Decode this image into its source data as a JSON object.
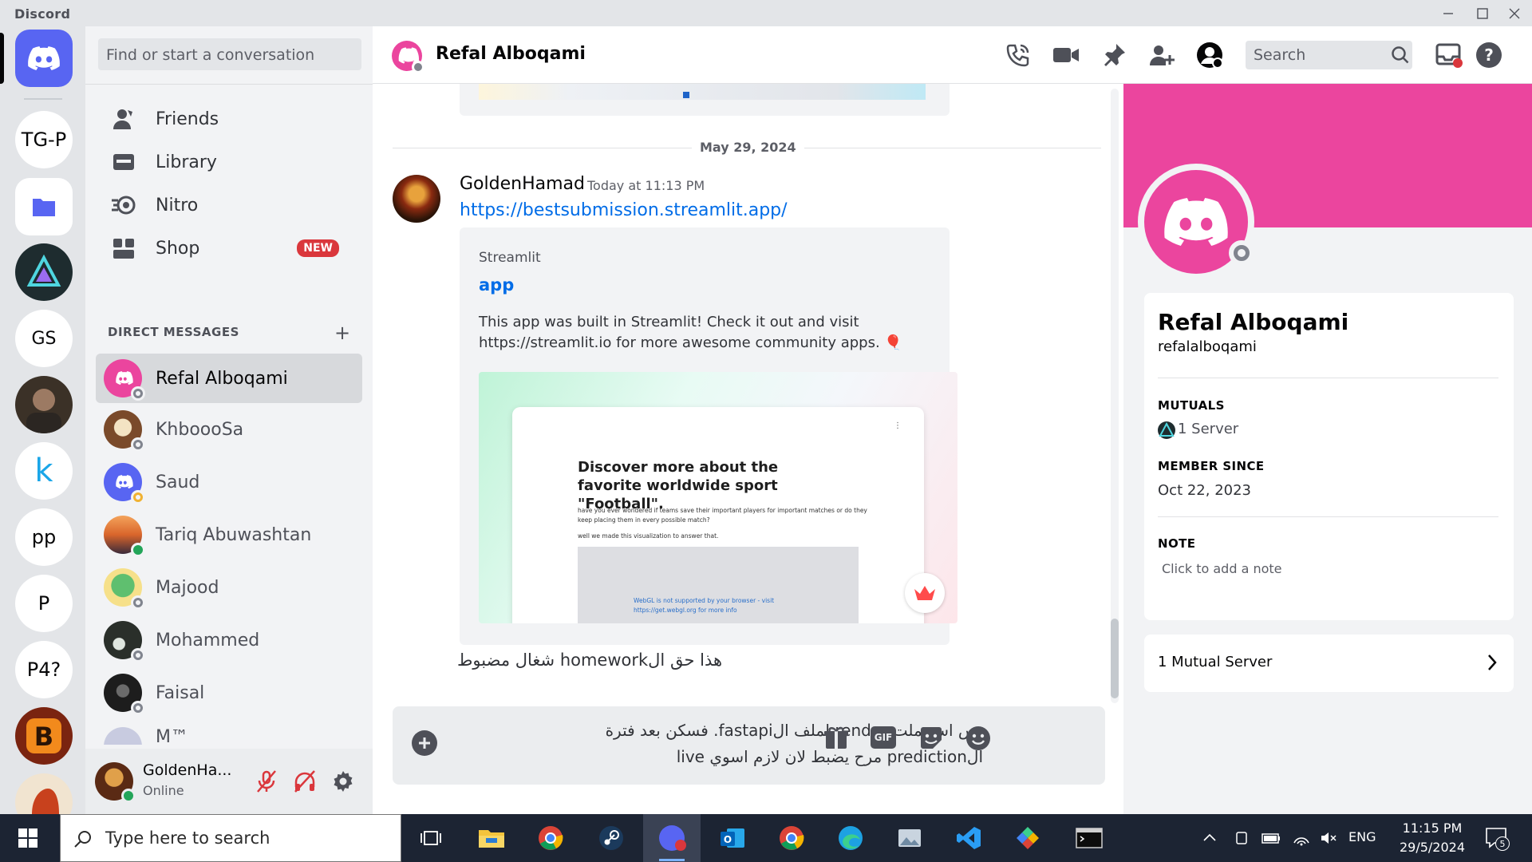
{
  "window": {
    "app_name": "Discord"
  },
  "servers": [
    "TG-P",
    "GS",
    "k",
    "pp",
    "P",
    "P4?"
  ],
  "sidebar": {
    "search_placeholder": "Find or start a conversation",
    "nav": [
      {
        "label": "Friends",
        "icon": "friends-icon"
      },
      {
        "label": "Library",
        "icon": "library-icon"
      },
      {
        "label": "Nitro",
        "icon": "nitro-icon"
      },
      {
        "label": "Shop",
        "icon": "shop-icon",
        "badge": "NEW"
      }
    ],
    "dm_header": "DIRECT MESSAGES",
    "dms": [
      {
        "name": "Refal Alboqami",
        "status": "offline",
        "color": "#eb459e"
      },
      {
        "name": "KhboooSa",
        "status": "offline",
        "color": "#7a4a2a"
      },
      {
        "name": "Saud",
        "status": "idle",
        "color": "#5865f2"
      },
      {
        "name": "Tariq Abuwashtan",
        "status": "online",
        "color": "#d9652b"
      },
      {
        "name": "Majood",
        "status": "offline",
        "color": "#8fd19e"
      },
      {
        "name": "Mohammed",
        "status": "offline",
        "color": "#2a2f2a"
      },
      {
        "name": "Faisal",
        "status": "offline",
        "color": "#1d1d1d"
      },
      {
        "name": "M™",
        "status": "offline",
        "color": "#c8cbe0"
      }
    ],
    "user": {
      "name": "GoldenHa...",
      "status": "Online"
    }
  },
  "chat": {
    "title": "Refal Alboqami",
    "search_placeholder": "Search",
    "date_divider": "May 29, 2024",
    "message": {
      "author": "GoldenHamad",
      "time": "Today at 11:13 PM",
      "link": "https://bestsubmission.streamlit.app/",
      "embed": {
        "provider": "Streamlit",
        "title": "app",
        "description": "This app was built in Streamlit! Check it out and visit https://streamlit.io for more awesome community apps. 🎈",
        "preview_heading": "Discover more about the favorite worldwide sport \"Football\".",
        "preview_text1": "have you ever wondered if teams save their important players for important matches or do they keep placing them in every possible match?",
        "preview_text2": "well we made this visualization to answer that.",
        "preview_webgl": "WebGL is not supported by your browser - visit https://get.webgl.org for more info"
      },
      "followup": "هذا حق الhomework شغال مضبوط"
    },
    "composer": {
      "line1": "بس استعملت render لملف الfastapi. فسكن بعد فترة",
      "line2": "الprediction مرح يضبط لان لازم اسوي live"
    }
  },
  "profile": {
    "display_name": "Refal Alboqami",
    "username": "refalalboqami",
    "mutuals_label": "MUTUALS",
    "mutuals_value": "1 Server",
    "member_since_label": "MEMBER SINCE",
    "member_since_value": "Oct 22, 2023",
    "note_label": "NOTE",
    "note_placeholder": "Click to add a note",
    "mutual_server_row": "1 Mutual Server",
    "banner_color": "#eb459e"
  },
  "taskbar": {
    "search_placeholder": "Type here to search",
    "language": "ENG",
    "time": "11:15 PM",
    "date": "29/5/2024",
    "notifications": "5"
  }
}
